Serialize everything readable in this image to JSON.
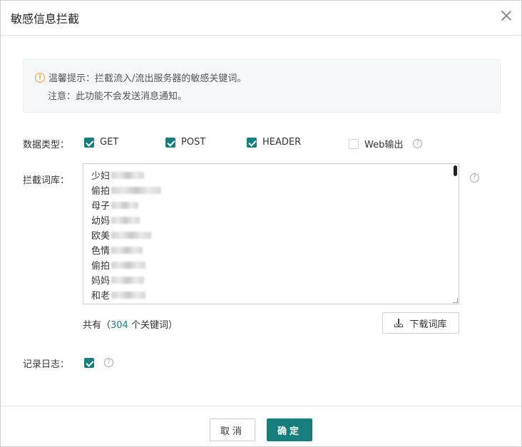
{
  "dialog": {
    "title": "敏感信息拦截",
    "close_icon": "close-icon"
  },
  "tip": {
    "icon": "warning-icon",
    "line1": "温馨提示：拦截流入/流出服务器的敏感关键词。",
    "line2": "注意：此功能不会发送消息通知。"
  },
  "data_type": {
    "label": "数据类型：",
    "options": [
      {
        "label": "GET",
        "checked": true
      },
      {
        "label": "POST",
        "checked": true
      },
      {
        "label": "HEADER",
        "checked": true
      },
      {
        "label": "Web输出",
        "checked": false
      }
    ]
  },
  "lexicon": {
    "label": "拦截词库：",
    "lines": [
      "少妇",
      "偷拍",
      "母子",
      "幼妈",
      "欧美",
      "色情",
      "偷拍",
      "妈妈",
      "和老"
    ]
  },
  "count": {
    "prefix": "共有（",
    "number": "304",
    "suffix": " 个关键词）"
  },
  "download_button": "下载词库",
  "log": {
    "label": "记录日志：",
    "checked": true
  },
  "footer": {
    "cancel": "取消",
    "ok": "确定"
  },
  "colors": {
    "accent": "#177e7e",
    "warning": "#f5a13a"
  }
}
